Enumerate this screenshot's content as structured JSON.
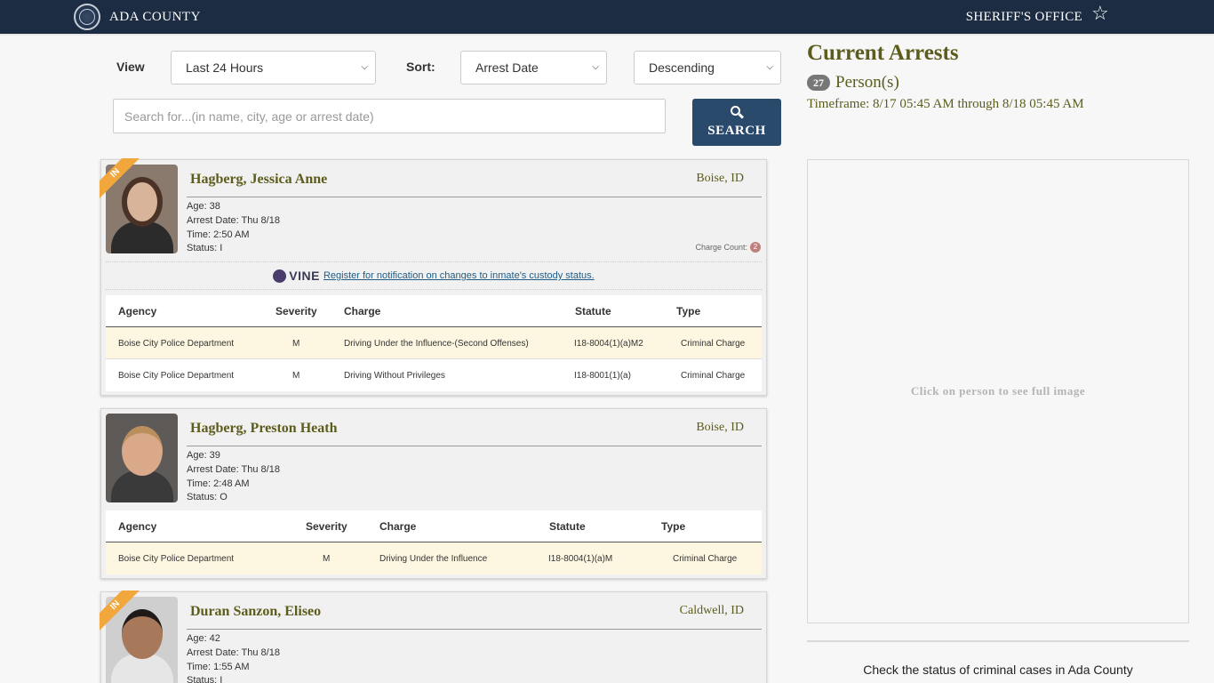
{
  "header": {
    "county": "ADA COUNTY",
    "office": "SHERIFF'S OFFICE",
    "logo_text": "Ada County Sheriff's Office"
  },
  "filters": {
    "view_label": "View",
    "view_value": "Last 24 Hours",
    "sort_label": "Sort:",
    "sort_value": "Arrest Date",
    "order_value": "Descending",
    "search_placeholder": "Search for...(in name, city, age or arrest date)",
    "search_button": "SEARCH"
  },
  "summary": {
    "title": "Current Arrests",
    "count": "27",
    "count_label": "Person(s)",
    "timeframe": "Timeframe: 8/17 05:45 AM through 8/18 05:45 AM",
    "image_hint": "Click on person to see full image",
    "check_status": "Check the status of criminal cases in Ada County"
  },
  "columns": {
    "agency": "Agency",
    "severity": "Severity",
    "charge": "Charge",
    "statute": "Statute",
    "type": "Type"
  },
  "vine": {
    "logo": "VINE",
    "link": "Register for notification on changes to inmate's custody status."
  },
  "arrests": [
    {
      "name": "Hagberg, Jessica Anne",
      "city": "Boise, ID",
      "status_tag": "IN",
      "age": "Age: 38",
      "arrest_date": "Arrest Date: Thu 8/18",
      "time": "Time: 2:50 AM",
      "status": "Status: I",
      "charge_count_label": "Charge Count:",
      "charge_count": "2",
      "charges": [
        {
          "agency": "Boise City Police Department",
          "severity": "M",
          "charge": "Driving Under the Influence-(Second Offenses)",
          "statute": "I18-8004(1)(a)M2",
          "type": "Criminal Charge"
        },
        {
          "agency": "Boise City Police Department",
          "severity": "M",
          "charge": "Driving Without Privileges",
          "statute": "I18-8001(1)(a)",
          "type": "Criminal Charge"
        }
      ]
    },
    {
      "name": "Hagberg, Preston Heath",
      "city": "Boise, ID",
      "age": "Age: 39",
      "arrest_date": "Arrest Date: Thu 8/18",
      "time": "Time: 2:48 AM",
      "status": "Status: O",
      "charges": [
        {
          "agency": "Boise City Police Department",
          "severity": "M",
          "charge": "Driving Under the Influence",
          "statute": "I18-8004(1)(a)M",
          "type": "Criminal Charge"
        }
      ]
    },
    {
      "name": "Duran Sanzon, Eliseo",
      "city": "Caldwell, ID",
      "status_tag": "IN",
      "age": "Age: 42",
      "arrest_date": "Arrest Date: Thu 8/18",
      "time": "Time: 1:55 AM",
      "status": "Status: I"
    }
  ]
}
